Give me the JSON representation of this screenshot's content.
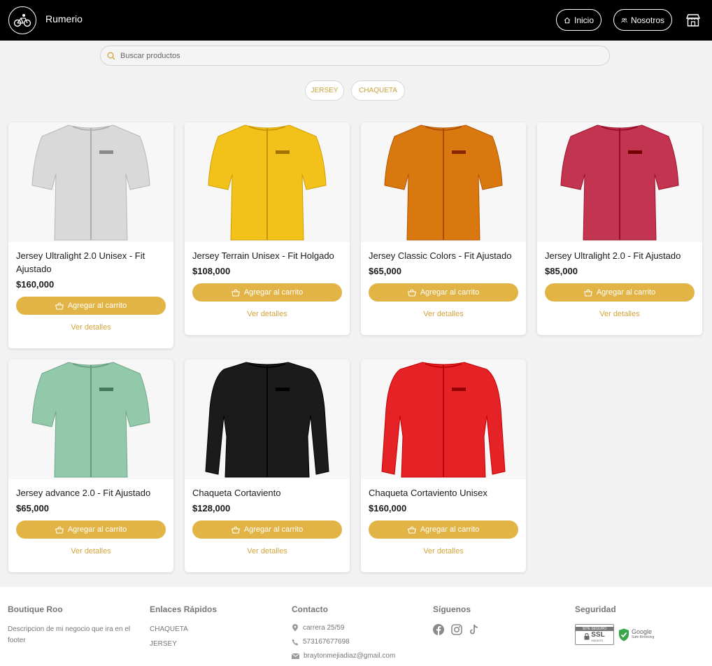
{
  "header": {
    "brand": "Rumerio",
    "nav": {
      "home": "Inicio",
      "about": "Nosotros"
    }
  },
  "search": {
    "placeholder": "Buscar productos"
  },
  "categories": [
    "JERSEY",
    "CHAQUETA"
  ],
  "products": [
    {
      "name": "Jersey Ultralight 2.0 Unisex - Fit Ajustado",
      "price": "$160,000",
      "add": "Agregar al carrito",
      "details": "Ver detalles",
      "color": "#d9d9d9",
      "sleeve": "short"
    },
    {
      "name": "Jersey Terrain Unisex - Fit Holgado",
      "price": "$108,000",
      "add": "Agregar al carrito",
      "details": "Ver detalles",
      "color": "#f2c21b",
      "sleeve": "short"
    },
    {
      "name": "Jersey Classic Colors - Fit Ajustado",
      "price": "$65,000",
      "add": "Agregar al carrito",
      "details": "Ver detalles",
      "color": "#d9780f",
      "sleeve": "short"
    },
    {
      "name": "Jersey Ultralight 2.0 - Fit Ajustado",
      "price": "$85,000",
      "add": "Agregar al carrito",
      "details": "Ver detalles",
      "color": "#c2344f",
      "sleeve": "short"
    },
    {
      "name": "Jersey advance 2.0 - Fit Ajustado",
      "price": "$65,000",
      "add": "Agregar al carrito",
      "details": "Ver detalles",
      "color": "#93c9ab",
      "sleeve": "short"
    },
    {
      "name": "Chaqueta Cortaviento",
      "price": "$128,000",
      "add": "Agregar al carrito",
      "details": "Ver detalles",
      "color": "#1b1b1b",
      "sleeve": "long"
    },
    {
      "name": "Chaqueta Cortaviento Unisex",
      "price": "$160,000",
      "add": "Agregar al carrito",
      "details": "Ver detalles",
      "color": "#e52226",
      "sleeve": "long"
    }
  ],
  "footer": {
    "about": {
      "title": "Boutique Roo",
      "text": "Descripcion de mi negocio que ira en el footer"
    },
    "links": {
      "title": "Enlaces Rápidos",
      "items": [
        "CHAQUETA",
        "JERSEY"
      ]
    },
    "contact": {
      "title": "Contacto",
      "address": "carrera 25/59",
      "phone": "573167677698",
      "email": "braytonmejiadiaz@gmail.com"
    },
    "social": {
      "title": "Síguenos",
      "icons": [
        "facebook-icon",
        "instagram-icon",
        "tiktok-icon"
      ]
    },
    "security": {
      "title": "Seguridad",
      "ssl_top": "SITE SEGURO",
      "ssl_main": "SSL",
      "ssl_sub": "256 BITS",
      "google_main": "Google",
      "google_sub": "Safe Browsing"
    }
  },
  "colors": {
    "accent": "#e2b446",
    "accent_text": "#d4a43c",
    "header_bg": "#000000"
  }
}
